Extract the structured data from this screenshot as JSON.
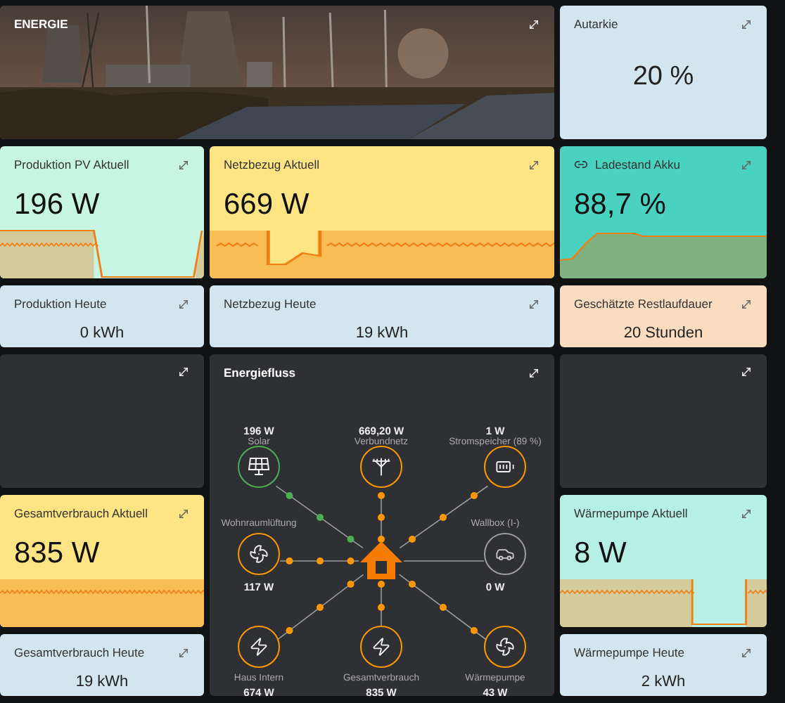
{
  "tiles": [
    {
      "kind": "picture",
      "title": "ENERGIE"
    },
    {
      "kind": "stat_large",
      "title": "Autarkie",
      "value": "20 %",
      "color": "#d3e5ee"
    },
    {
      "kind": "graph",
      "title": "Produktion PV Aktuell",
      "value": "196 W",
      "color": "#c6f5e2"
    },
    {
      "kind": "graph",
      "title": "Netzbezug Aktuell",
      "value": "669 W",
      "color": "#fee482"
    },
    {
      "kind": "graph",
      "title": "Ladestand Akku",
      "value": "88,7 %",
      "color": "#48d2bf",
      "link": true
    },
    {
      "kind": "stat",
      "title": "Produktion Heute",
      "value": "0 kWh",
      "color": "#d3e5ee"
    },
    {
      "kind": "stat",
      "title": "Netzbezug Heute",
      "value": "19 kWh",
      "color": "#d3e5ee"
    },
    {
      "kind": "stat",
      "title": "Geschätzte Restlaufdauer",
      "value": "20 Stunden",
      "color": "#fadcc0"
    }
  ],
  "left_column": [
    {
      "kind": "blank"
    },
    {
      "kind": "graph",
      "title": "Gesamtverbrauch Aktuell",
      "value": "835 W",
      "color": "#fee482"
    },
    {
      "kind": "stat",
      "title": "Gesamtverbrauch Heute",
      "value": "19 kWh",
      "color": "#d3e5ee"
    }
  ],
  "energy_flow": {
    "kind": "flow",
    "title": "Energiefluss",
    "nodes": [
      {
        "label": "Solar",
        "value": "196 W",
        "color": "#4caf50",
        "active": true
      },
      {
        "label": "Verbundnetz",
        "value": "669,20 W",
        "color": "#ff9800",
        "active": true
      },
      {
        "label": "Stromspeicher (89 %)",
        "value": "1 W",
        "color": "#ff9800",
        "active": true
      },
      {
        "label": "Wohnraumlüftung",
        "value": "117 W",
        "color": "#ff9800",
        "active": true
      },
      {
        "label": "Wallbox (I-)",
        "value": "0 W",
        "color": "#9e9e9e",
        "active": false
      },
      {
        "label": "Haus Intern",
        "value": "674 W",
        "color": "#ff9800",
        "active": true
      },
      {
        "label": "Gesamtverbrauch",
        "value": "835 W",
        "color": "#ff9800",
        "active": true
      },
      {
        "label": "Wärmepumpe",
        "value": "43 W",
        "color": "#ff9800",
        "active": true
      }
    ]
  },
  "right_column": [
    {
      "kind": "blank"
    },
    {
      "kind": "graph",
      "title": "Wärmepumpe Aktuell",
      "value": "8 W",
      "color": "#b6efe3"
    },
    {
      "kind": "stat",
      "title": "Wärmepumpe Heute",
      "value": "2 kWh",
      "color": "#d3e5ee"
    }
  ]
}
